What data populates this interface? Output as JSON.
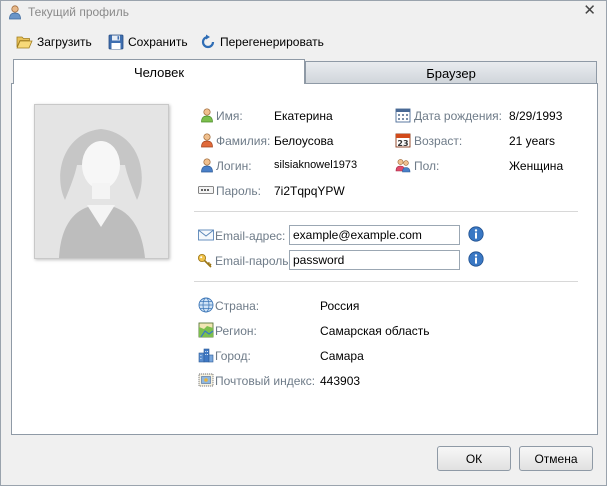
{
  "window": {
    "title": "Текущий профиль",
    "close_glyph": "✕"
  },
  "toolbar": {
    "load_label": "Загрузить",
    "save_label": "Сохранить",
    "regenerate_label": "Перегенерировать"
  },
  "tabs": {
    "person": "Человек",
    "browser": "Браузер"
  },
  "person": {
    "first_name_label": "Имя:",
    "first_name": "Екатерина",
    "last_name_label": "Фамилия:",
    "last_name": "Белоусова",
    "login_label": "Логин:",
    "login": "silsiaknowel1973",
    "password_label": "Пароль:",
    "password": "7i2TqpqYPW",
    "birthdate_label": "Дата рождения:",
    "birthdate": "8/29/1993",
    "age_label": "Возраст:",
    "age": "21 years",
    "gender_label": "Пол:",
    "gender": "Женщина"
  },
  "email": {
    "address_label": "Email-адрес:",
    "address": "example@example.com",
    "password_label": "Email-пароль:",
    "password": "password"
  },
  "location": {
    "country_label": "Страна:",
    "country": "Россия",
    "region_label": "Регион:",
    "region": "Самарская область",
    "city_label": "Город:",
    "city": "Самара",
    "zip_label": "Почтовый индекс:",
    "zip": "443903"
  },
  "buttons": {
    "ok": "ОК",
    "cancel": "Отмена"
  },
  "icons": {
    "title": "user-icon",
    "load": "folder-open-icon",
    "save": "floppy-icon",
    "regenerate": "refresh-icon",
    "info": "info-icon"
  }
}
